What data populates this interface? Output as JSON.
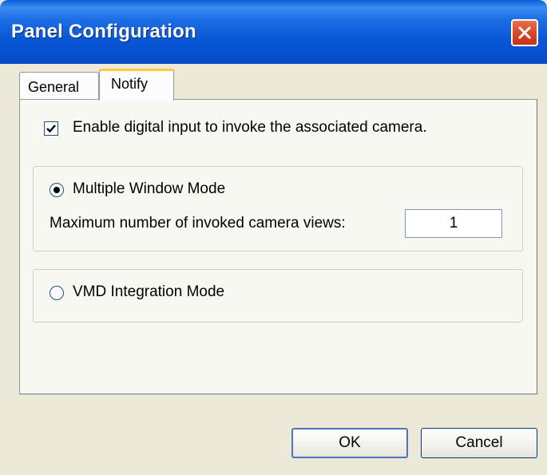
{
  "window": {
    "title": "Panel Configuration"
  },
  "tabs": [
    {
      "label": "General",
      "selected": false
    },
    {
      "label": "Notify",
      "selected": true
    }
  ],
  "notify": {
    "enable_checkbox": {
      "label": "Enable digital input to invoke the associated camera.",
      "checked": true
    },
    "multiple_window_mode": {
      "label": "Multiple Window Mode",
      "selected": true,
      "max_views_label": "Maximum number of invoked camera views:",
      "max_views_value": "1"
    },
    "vmd_integration_mode": {
      "label": "VMD Integration Mode",
      "selected": false
    }
  },
  "buttons": {
    "ok": "OK",
    "cancel": "Cancel"
  },
  "colors": {
    "titlebar": "#0a58d6",
    "close": "#d9482a",
    "face": "#ece9d8",
    "tab_highlight": "#ffc83c"
  },
  "icons": {
    "close": "close-icon",
    "check": "checkmark-icon"
  }
}
